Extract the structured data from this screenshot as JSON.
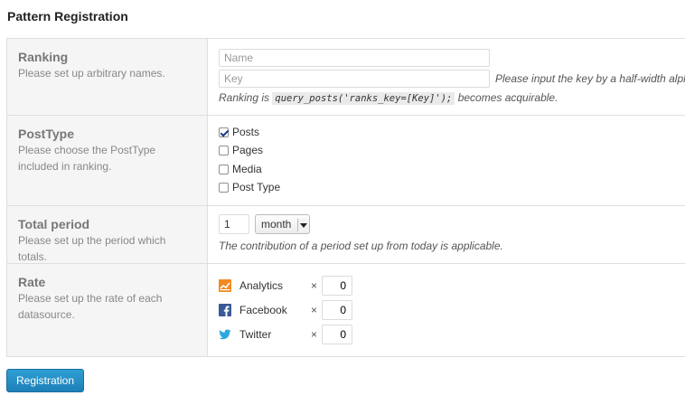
{
  "page_title": "Pattern Registration",
  "ranking": {
    "label": "Ranking",
    "desc": "Please set up arbitrary names.",
    "name_placeholder": "Name",
    "key_placeholder": "Key",
    "key_hint": "Please input the key by a half-width alph",
    "info_prefix": "Ranking is",
    "info_code": "query_posts('ranks_key=[Key]');",
    "info_suffix": "becomes acquirable."
  },
  "posttype": {
    "label": "PostType",
    "desc": "Please choose the PostType included in ranking.",
    "options": [
      {
        "label": "Posts",
        "checked": true
      },
      {
        "label": "Pages",
        "checked": false
      },
      {
        "label": "Media",
        "checked": false
      },
      {
        "label": "Post Type",
        "checked": false
      }
    ]
  },
  "period": {
    "label": "Total period",
    "desc": "Please set up the period which totals.",
    "value": "1",
    "unit": "month",
    "note": "The contribution of a period set up from today is applicable."
  },
  "rate": {
    "label": "Rate",
    "desc": "Please set up the rate of each datasource.",
    "times": "×",
    "sources": [
      {
        "name": "Analytics",
        "value": "0",
        "icon": "analytics-icon",
        "color": "#f18a21"
      },
      {
        "name": "Facebook",
        "value": "0",
        "icon": "facebook-icon",
        "color": "#3b5998"
      },
      {
        "name": "Twitter",
        "value": "0",
        "icon": "twitter-icon",
        "color": "#2aa9e0"
      }
    ]
  },
  "submit_label": "Registration"
}
